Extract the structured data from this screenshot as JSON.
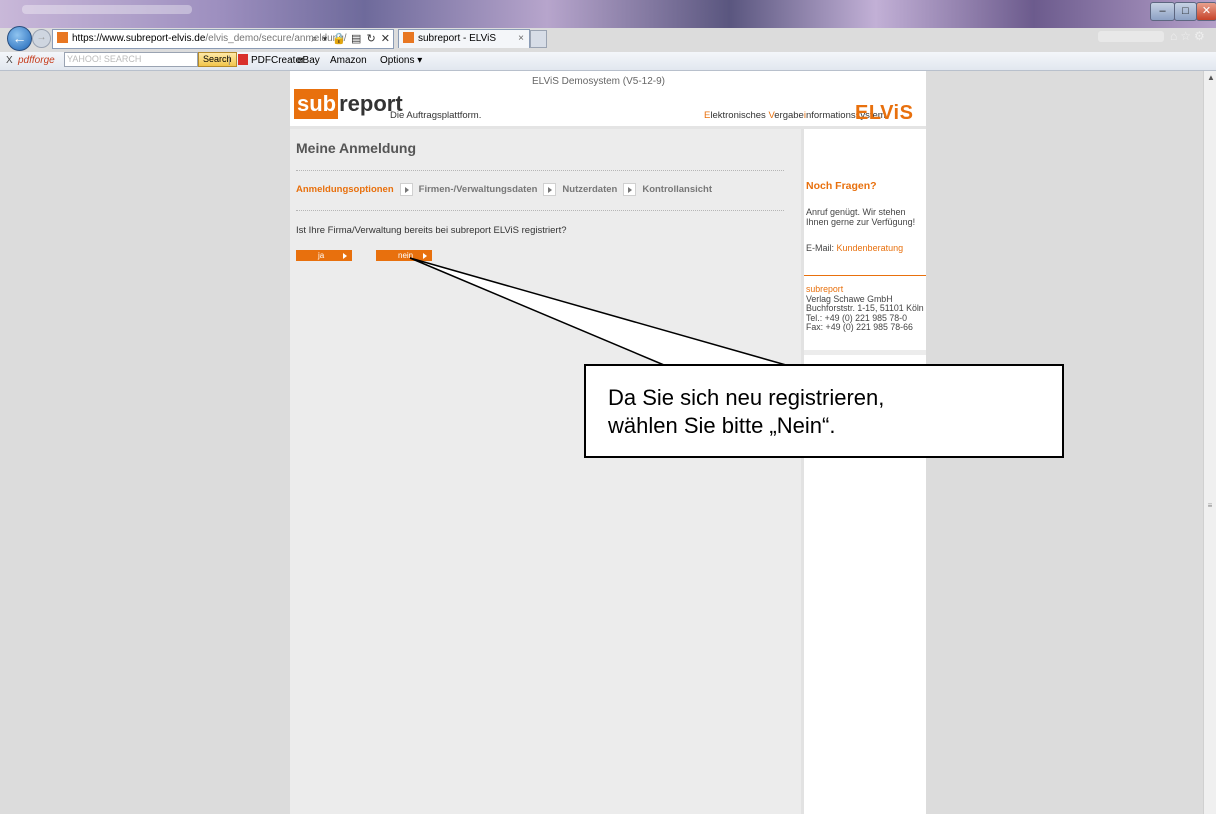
{
  "browser": {
    "url_domain": "https://www.subreport-elvis.de",
    "url_path": "/elvis_demo/secure/anmeldung/",
    "address_tools": "⌕ ▾ 🔒 ▤ ↻ ✕",
    "tab_title": "subreport - ELViS",
    "tab_close": "×",
    "toolbar": {
      "close": "X",
      "pdfforge": "pdfforge",
      "search_placeholder": "YAHOO! SEARCH",
      "search_button": "Search",
      "pdfcreator": "PDFCreator",
      "ebay": "eBay",
      "amazon": "Amazon",
      "options": "Options ▾"
    }
  },
  "header": {
    "version": "ELViS Demosystem (V5-12-9)",
    "logo_sub": "sub",
    "logo_report": "report",
    "tagline": "Die Auftragsplattform.",
    "elvis_parts": [
      {
        "t": "E",
        "hl": true
      },
      {
        "t": "lektronisches ",
        "hl": false
      },
      {
        "t": "V",
        "hl": true
      },
      {
        "t": "ergabe",
        "hl": false
      },
      {
        "t": "i",
        "hl": true
      },
      {
        "t": "nformations",
        "hl": false
      },
      {
        "t": "s",
        "hl": true
      },
      {
        "t": "ystem",
        "hl": false
      }
    ],
    "elvis_logo": "ELViS"
  },
  "main": {
    "title": "Meine Anmeldung",
    "steps": [
      "Anmeldungsoptionen",
      "Firmen-/Verwaltungsdaten",
      "Nutzerdaten",
      "Kontrollansicht"
    ],
    "question": "Ist Ihre Firma/Verwaltung bereits bei subreport ELViS registriert?",
    "btn_ja": "ja",
    "btn_nein": "nein"
  },
  "sidebar": {
    "heading": "Noch Fragen?",
    "text": "Anruf genügt. Wir stehen Ihnen gerne zur Verfügung!",
    "email_label": "E-Mail:",
    "email_link": "Kundenberatung",
    "address": {
      "brand": "subreport",
      "company": "Verlag Schawe GmbH",
      "street": "Buchforststr. 1-15, 51101 Köln",
      "tel": "Tel.: +49 (0) 221 985 78-0",
      "fax": "Fax: +49 (0) 221 985 78-66"
    }
  },
  "callout": {
    "line1": "Da Sie sich neu registrieren,",
    "line2": "wählen Sie bitte „Nein“."
  },
  "colors": {
    "accent": "#e8700d",
    "page_bg": "#dcdcdc",
    "panel_bg": "#ececec"
  }
}
